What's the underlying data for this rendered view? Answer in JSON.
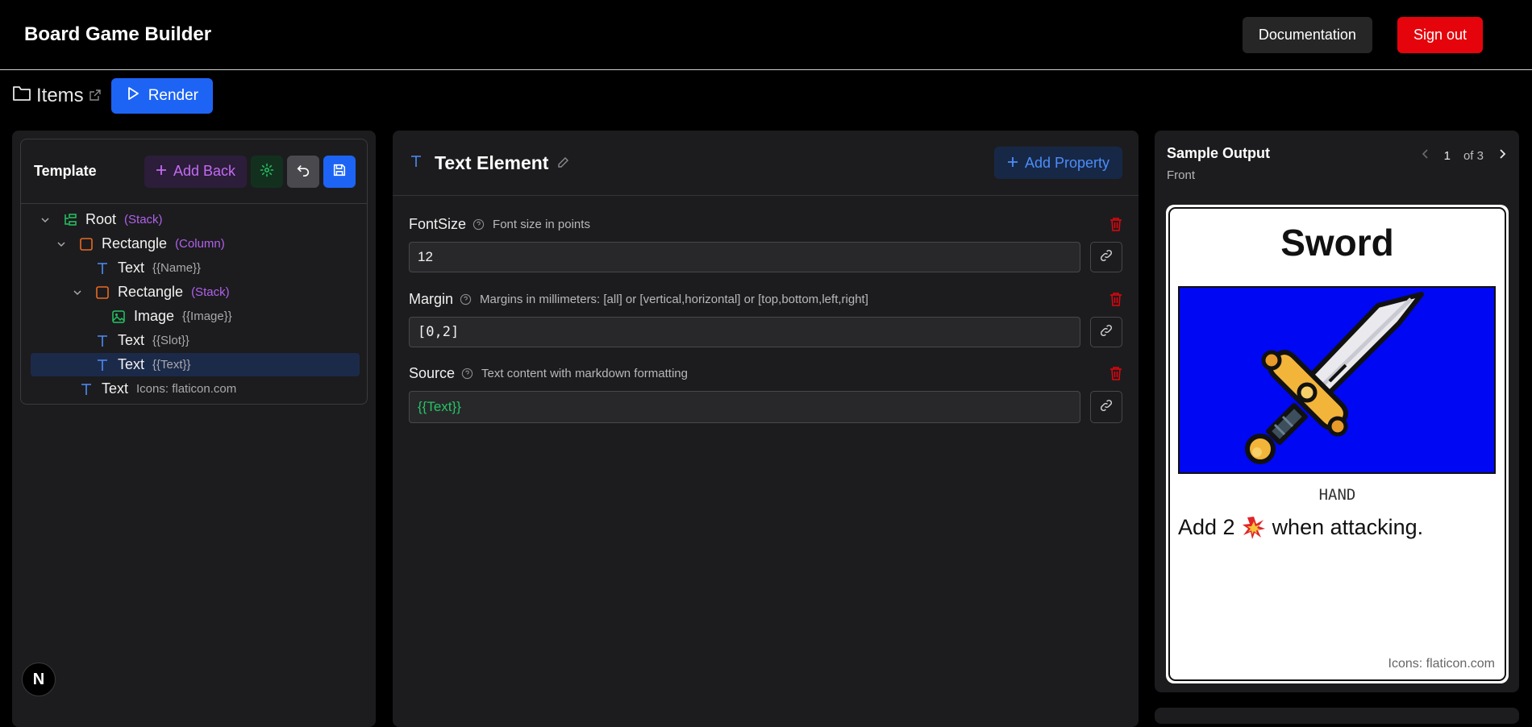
{
  "header": {
    "app_title": "Board Game Builder",
    "documentation_label": "Documentation",
    "signout_label": "Sign out"
  },
  "breadcrumb": {
    "label": "Items",
    "render_label": "Render"
  },
  "template": {
    "title": "Template",
    "add_back_label": "Add Back",
    "tree": [
      {
        "name": "Root",
        "tag": "(Stack)"
      },
      {
        "name": "Rectangle",
        "tag": "(Column)"
      },
      {
        "name": "Text",
        "tag": "{{Name}}"
      },
      {
        "name": "Rectangle",
        "tag": "(Stack)"
      },
      {
        "name": "Image",
        "tag": "{{Image}}"
      },
      {
        "name": "Text",
        "tag": "{{Slot}}"
      },
      {
        "name": "Text",
        "tag": "{{Text}}"
      },
      {
        "name": "Text",
        "tag": "Icons: flaticon.com"
      }
    ]
  },
  "element": {
    "title": "Text Element",
    "add_property_label": "Add Property",
    "properties": [
      {
        "name": "FontSize",
        "description": "Font size in points",
        "value": "12"
      },
      {
        "name": "Margin",
        "description": "Margins in millimeters: [all] or [vertical,horizontal] or [top,bottom,left,right]",
        "value": "[0,2]"
      },
      {
        "name": "Source",
        "description": "Text content with markdown formatting",
        "value": "{{Text}}"
      }
    ]
  },
  "sample_output": {
    "title": "Sample Output",
    "side": "Front",
    "page": "1",
    "page_total": "of 3",
    "card": {
      "name": "Sword",
      "slot": "HAND",
      "text_prefix": "Add 2",
      "text_suffix": "when attacking.",
      "credit": "Icons: flaticon.com",
      "image_background": "#0007f2"
    }
  },
  "colors": {
    "accent_blue": "#1d64f5",
    "danger_red": "#e5040c",
    "purple": "#b260ee",
    "green": "#25c463"
  }
}
